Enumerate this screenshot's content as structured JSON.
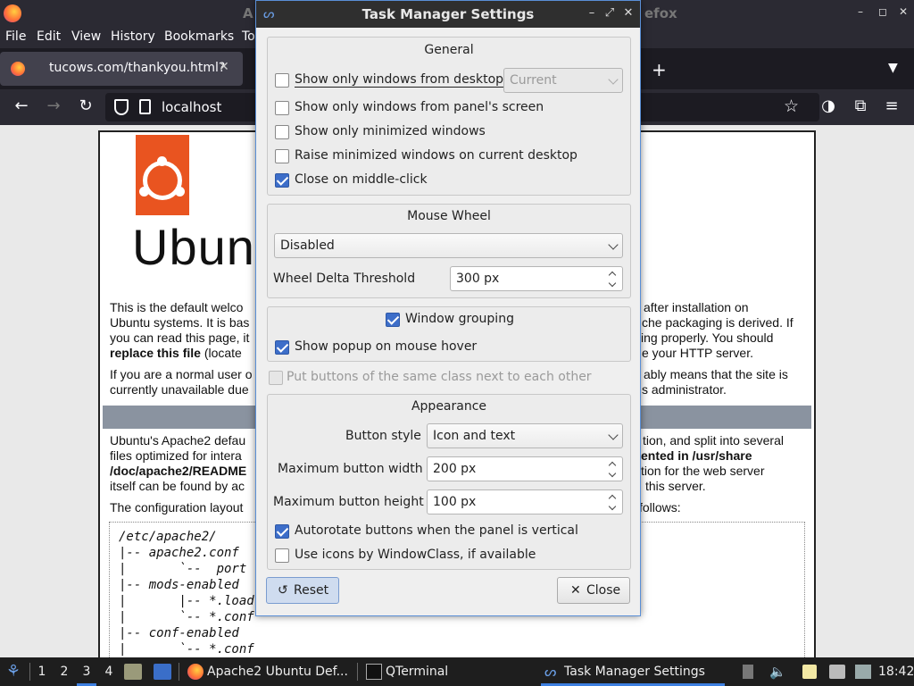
{
  "browser": {
    "window_title_left": "A",
    "window_title_right": "efox",
    "menu": [
      {
        "label": "File"
      },
      {
        "label": "Edit"
      },
      {
        "label": "View"
      },
      {
        "label": "History"
      },
      {
        "label": "Bookmarks"
      },
      {
        "label": "To"
      }
    ],
    "tab": {
      "title": "tucows.com/thankyou.html?",
      "close": "✕"
    },
    "new_tab": "+",
    "url": "localhost",
    "page": {
      "logo_word": "Ubuntu",
      "para1_l1": "This is the default welco",
      "para1_l1r": "after installation on",
      "para1_l2": "Ubuntu systems. It is bas",
      "para1_l2r": "che packaging is derived. If",
      "para1_l3": "you can read this page, it",
      "para1_l3r": "ing properly. You should",
      "para1_l4a": "replace this file",
      "para1_l4b": " (locate",
      "para1_l4r": "e your HTTP server.",
      "para2_l1": "If you are a normal user o",
      "para2_l1r": "ably means that the site is",
      "para2_l2": "currently unavailable due",
      "para2_l2r": "s administrator.",
      "para3_l1": "Ubuntu's Apache2 defau",
      "para3_l1r": "tion, and split into several",
      "para3_l2": "files optimized for intera",
      "para3_l2r": "ented in /usr/share",
      "para3_l3": "/doc/apache2/README",
      "para3_l3r": "tion for the web server",
      "para3_l4": "itself can be found by ac",
      "para3_l4r": "this server.",
      "para4_l1": "The configuration layout",
      "para4_l1r": "follows:",
      "code": [
        "/etc/apache2/",
        "|-- apache2.conf",
        "|       `--  port",
        "|-- mods-enabled",
        "|       |-- *.load",
        "|       `-- *.conf",
        "|-- conf-enabled",
        "|       `-- *.conf"
      ]
    }
  },
  "taskbar": {
    "desktops": [
      "1",
      "2",
      "3",
      "4"
    ],
    "tasks": [
      {
        "label": "Apache2 Ubuntu Def..."
      },
      {
        "label": "QTerminal"
      },
      {
        "label": "Task Manager Settings"
      }
    ],
    "clock": "18:42"
  },
  "dialog": {
    "title": "Task Manager Settings",
    "general": {
      "title": "General",
      "show_only_desktop": {
        "label": "Show only windows from desktop",
        "checked": false
      },
      "desktop_combo": "Current",
      "show_only_panel_screen": {
        "label": "Show only windows from panel's screen",
        "checked": false
      },
      "show_only_minimized": {
        "label": "Show only minimized windows",
        "checked": false
      },
      "raise_minimized": {
        "label": "Raise minimized windows on current desktop",
        "checked": false
      },
      "close_middle_click": {
        "label": "Close on middle-click",
        "checked": true
      }
    },
    "mouse_wheel": {
      "title": "Mouse Wheel",
      "mode": "Disabled",
      "delta_label": "Wheel Delta Threshold",
      "delta_value": "300 px"
    },
    "grouping": {
      "window_grouping": {
        "label": "Window grouping",
        "checked": true
      },
      "popup_hover": {
        "label": "Show popup on mouse hover",
        "checked": true
      }
    },
    "same_class": {
      "label": "Put buttons of the same class next to each other",
      "checked": false,
      "disabled": true
    },
    "appearance": {
      "title": "Appearance",
      "button_style_label": "Button style",
      "button_style_value": "Icon and text",
      "max_width_label": "Maximum button width",
      "max_width_value": "200 px",
      "max_height_label": "Maximum button height",
      "max_height_value": "100 px",
      "autorotate": {
        "label": "Autorotate buttons when the panel is vertical",
        "checked": true
      },
      "icons_wmclass": {
        "label": "Use icons by WindowClass, if available",
        "checked": false
      }
    },
    "reset_label": "Reset",
    "close_label": "Close"
  },
  "colors": {
    "accent": "#3d6ec9",
    "ubuntu_orange": "#e95420",
    "dark_chrome": "#2b2a33"
  },
  "icons": [
    "firefox-icon",
    "search-tab-list-icon",
    "back-arrow-icon",
    "forward-arrow-icon",
    "reload-icon",
    "shield-icon",
    "page-icon",
    "bookmark-star-icon",
    "reset-icon",
    "close-icon",
    "volume-icon",
    "network-icon",
    "lxqt-menu-icon"
  ]
}
